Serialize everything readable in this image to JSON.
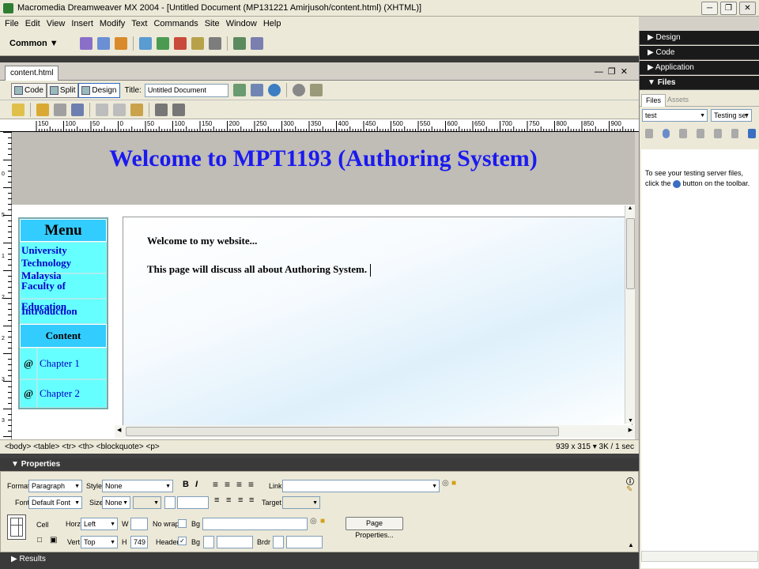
{
  "window": {
    "title": "Macromedia Dreamweaver MX 2004 - [Untitled Document (MP131221 Amirjusoh/content.html) (XHTML)]"
  },
  "menubar": {
    "items": [
      "File",
      "Edit",
      "View",
      "Insert",
      "Modify",
      "Text",
      "Commands",
      "Site",
      "Window",
      "Help"
    ]
  },
  "insert_bar": {
    "category": "Common"
  },
  "document": {
    "tab": "content.html",
    "view_buttons": {
      "code": "Code",
      "split": "Split",
      "design": "Design"
    },
    "title_label": "Title:",
    "title_value": "Untitled Document"
  },
  "ruler": {
    "labels": [
      "150",
      "100",
      "50",
      "0",
      "50",
      "100",
      "150",
      "200",
      "250",
      "300",
      "350",
      "400",
      "450",
      "500",
      "550",
      "600",
      "650",
      "700",
      "750",
      "800",
      "850",
      "900"
    ]
  },
  "vruler": {
    "labels": [
      "0",
      "5",
      "1",
      "2",
      "2",
      "3",
      "3"
    ]
  },
  "page": {
    "banner": "Welcome to MPT1193 (Authoring System)",
    "menu": {
      "header": "Menu",
      "links": [
        "University Technology Malaysia",
        "Faculty of Education",
        "Introduction"
      ],
      "content_header": "Content",
      "chapters": [
        {
          "bullet": "@",
          "label": "Chapter 1"
        },
        {
          "bullet": "@",
          "label": "Chapter 2"
        }
      ]
    },
    "content": {
      "line1": "Welcome to my website...",
      "line2": "This page will discuss all about Authoring System."
    }
  },
  "statusbar": {
    "tags": "<body> <table> <tr> <th> <blockquote> <p>",
    "size": "939 x 315 ▾ 3K / 1 sec"
  },
  "properties": {
    "header": "Properties",
    "format_label": "Format",
    "format_value": "Paragraph",
    "style_label": "Style",
    "style_value": "None",
    "bold": "B",
    "italic": "I",
    "link_label": "Link",
    "font_label": "Font",
    "font_value": "Default Font",
    "size_label": "Size",
    "size_value": "None",
    "target_label": "Target",
    "cell_label": "Cell",
    "horz_label": "Horz",
    "horz_value": "Left",
    "w_label": "W",
    "nowrap_label": "No wrap",
    "bg_label": "Bg",
    "page_props_button": "Page Properties...",
    "vert_label": "Vert",
    "vert_value": "Top",
    "h_label": "H",
    "h_value": "749",
    "header_label": "Header",
    "bg2_label": "Bg",
    "brdr_label": "Brdr"
  },
  "results": {
    "label": "Results"
  },
  "right_panels": {
    "design": "Design",
    "code": "Code",
    "application": "Application",
    "files": "Files",
    "tabs": [
      "Files",
      "Assets"
    ],
    "site_value": "test",
    "server_value": "Testing ser",
    "message_line1": "To see your testing server files,",
    "message_line2_a": "click the",
    "message_line2_b": "button on the toolbar."
  }
}
